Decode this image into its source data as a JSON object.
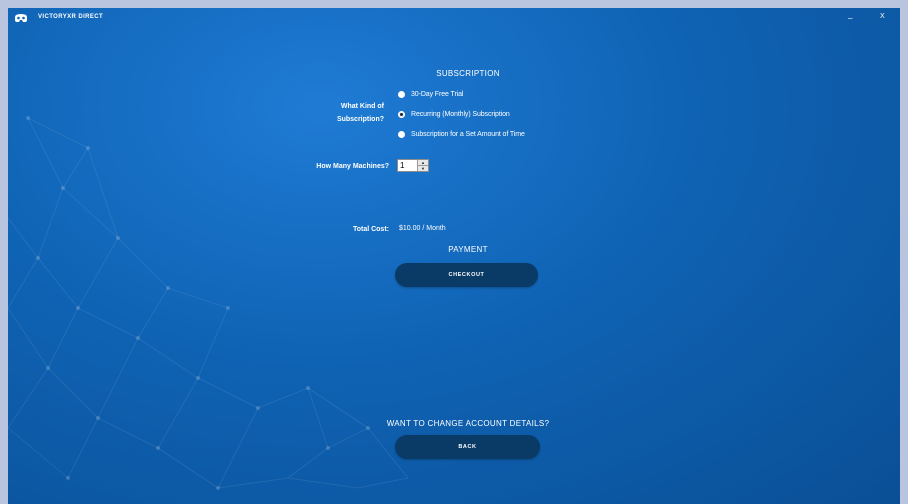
{
  "window": {
    "title": "VICTORYXR DIRECT",
    "minimize_label": "_",
    "close_label": "X"
  },
  "subscription": {
    "heading": "SUBSCRIPTION",
    "kind_label_line1": "What Kind of",
    "kind_label_line2": "Subscription?",
    "options": [
      {
        "label": "30-Day Free Trial",
        "selected": false
      },
      {
        "label": "Recurring (Monthly) Subscription",
        "selected": true
      },
      {
        "label": "Subscription for a Set Amount of Time",
        "selected": false
      }
    ],
    "machines_label": "How Many Machines?",
    "machines_value": "1",
    "total_label": "Total Cost:",
    "total_value": "$10.00 / Month"
  },
  "payment": {
    "heading": "PAYMENT",
    "checkout_label": "CHECKOUT"
  },
  "account": {
    "prompt": "WANT TO CHANGE ACCOUNT DETAILS?",
    "back_label": "BACK"
  },
  "colors": {
    "accent": "#0f63b4",
    "button_bg": "#0a3a66",
    "frame": "#b9c5de"
  },
  "icons": {
    "logo": "headset-icon",
    "spin_up": "triangle-up-icon",
    "spin_down": "triangle-down-icon"
  }
}
